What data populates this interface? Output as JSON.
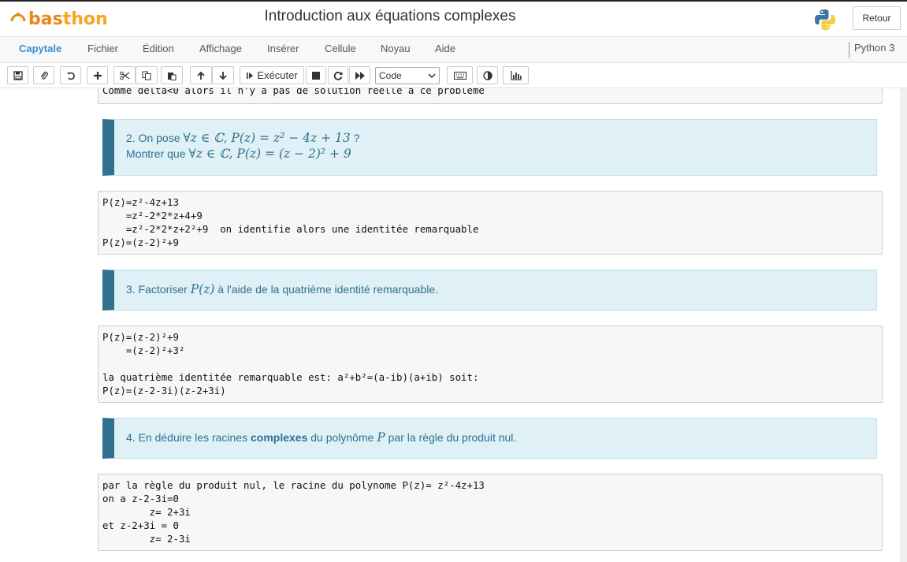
{
  "header": {
    "logo_text_a": "bas",
    "logo_text_b": "thon",
    "notebook_title": "Introduction aux  équations complexes",
    "back_label": "Retour"
  },
  "menubar": {
    "brand": "Capytale",
    "items": [
      "Fichier",
      "Édition",
      "Affichage",
      "Insérer",
      "Cellule",
      "Noyau",
      "Aide"
    ],
    "kernel": "Python 3"
  },
  "toolbar": {
    "run_label": "Exécuter",
    "cell_type": "Code",
    "icons": [
      "save-icon",
      "attach-icon",
      "undo-icon",
      "add-cell-icon",
      "cut-icon",
      "copy-icon",
      "paste-icon",
      "move-up-icon",
      "move-down-icon",
      "run-icon",
      "stop-icon",
      "restart-icon",
      "run-all-icon",
      "keyboard-icon",
      "contrast-icon",
      "chart-icon"
    ]
  },
  "cells": {
    "partial_output": "Comme delta<0 alors il n'y a pas de solution réelle à ce problème",
    "md2": {
      "line1_prefix": "2. On pose ",
      "line1_math": "∀z ∈ ℂ, P(z) = z² − 4z + 13",
      "line1_suffix": " ?",
      "line2_prefix": "Montrer que ",
      "line2_math": "∀z ∈ ℂ, P(z) = (z − 2)² + 9"
    },
    "code2": "P(z)=z²-4z+13\n    =z²-2*2*z+4+9\n    =z²-2*2*z+2²+9  on identifie alors une identitée remarquable\nP(z)=(z-2)²+9",
    "md3": {
      "prefix": "3. Factoriser ",
      "math": "P(z)",
      "suffix": " à l'aide de la quatrième identité remarquable."
    },
    "code3": "P(z)=(z-2)²+9\n    =(z-2)²+3²\n\nla quatrième identitée remarquable est: a²+b²=(a-ib)(a+ib) soit:\nP(z)=(z-2-3i)(z-2+3i)",
    "md4": {
      "prefix": "4. En déduire les racines ",
      "bold": "complexes",
      "middle": " du polynôme ",
      "math": "P",
      "suffix": " par la règle du produit nul."
    },
    "code4": "par la règle du produit nul, le racine du polynome P(z)= z²-4z+13\non a z-2-3i=0\n        z= 2+3i\net z-2+3i = 0\n        z= 2-3i"
  },
  "colors": {
    "brand_blue": "#3a8ccd",
    "logo_orange": "#f5a623",
    "md_text": "#31708f",
    "md_background": "#dff0f7"
  }
}
